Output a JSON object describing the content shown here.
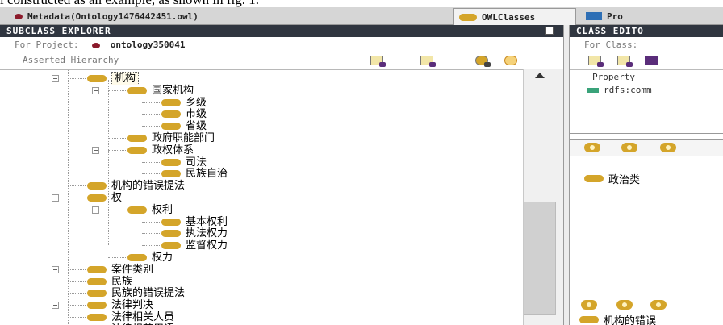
{
  "caption": "l constructed as an example, as shown in fig. 1.",
  "tabs": [
    {
      "label": "Metadata(Ontology1476442451.owl)",
      "icon": "diamond-icon"
    },
    {
      "label": "OWLClasses",
      "icon": "class-pill-icon"
    },
    {
      "label": "Pro",
      "icon": "properties-icon"
    }
  ],
  "left_panel": {
    "title": "SUBCLASS EXPLORER",
    "project_label": "For Project:",
    "project_name": "ontology350041",
    "hierarchy_label": "Asserted Hierarchy",
    "tree": [
      {
        "label": "机构",
        "level": 1,
        "expandable": true,
        "selected": true
      },
      {
        "label": "国家机构",
        "level": 2,
        "expandable": true
      },
      {
        "label": "乡级",
        "level": 3
      },
      {
        "label": "市级",
        "level": 3
      },
      {
        "label": "省级",
        "level": 3
      },
      {
        "label": "政府职能部门",
        "level": 2
      },
      {
        "label": "政权体系",
        "level": 2,
        "expandable": true
      },
      {
        "label": "司法",
        "level": 3
      },
      {
        "label": "民族自治",
        "level": 3
      },
      {
        "label": "机构的错误提法",
        "level": 1
      },
      {
        "label": "权",
        "level": 1,
        "expandable": true
      },
      {
        "label": "权利",
        "level": 2,
        "expandable": true
      },
      {
        "label": "基本权利",
        "level": 3
      },
      {
        "label": "执法权力",
        "level": 3
      },
      {
        "label": "监督权力",
        "level": 3
      },
      {
        "label": "权力",
        "level": 2
      },
      {
        "label": "案件类别",
        "level": 1,
        "expandable": true
      },
      {
        "label": "民族",
        "level": 1
      },
      {
        "label": "民族的错误提法",
        "level": 1
      },
      {
        "label": "法律判决",
        "level": 1,
        "expandable": true
      },
      {
        "label": "法律相关人员",
        "level": 1
      },
      {
        "label": "法律规范用语",
        "level": 1
      }
    ]
  },
  "right_panel": {
    "title": "CLASS EDITO",
    "class_label": "For Class:",
    "property_header": "Property",
    "property_row": "rdfs:comm",
    "superclass": "政治类",
    "bottom_item": "机构的错误"
  },
  "colors": {
    "header_bg": "#303640",
    "class_pill": "#d4a52a",
    "diamond": "#8b1a2b",
    "blue_tab_icon": "#2e6fb5"
  }
}
